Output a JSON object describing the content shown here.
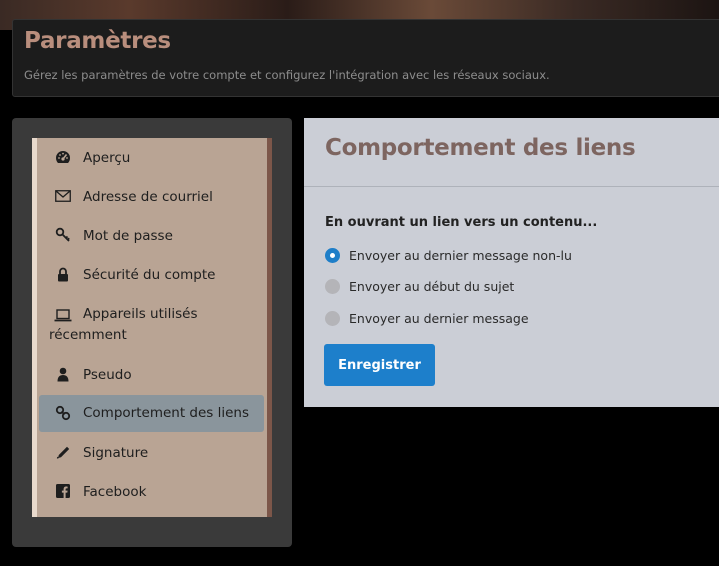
{
  "header": {
    "title": "Paramètres",
    "subtitle": "Gérez les paramètres de votre compte et configurez l'intégration avec les réseaux sociaux."
  },
  "sidebar": {
    "items": [
      {
        "label": "Aperçu",
        "icon": "gauge-icon"
      },
      {
        "label": "Adresse de courriel",
        "icon": "envelope-icon"
      },
      {
        "label": "Mot de passe",
        "icon": "key-icon"
      },
      {
        "label": "Sécurité du compte",
        "icon": "lock-icon"
      },
      {
        "label": "Appareils utilisés récemment",
        "label_line1": "Appareils utilisés",
        "label_line2": "récemment",
        "icon": "laptop-icon"
      },
      {
        "label": "Pseudo",
        "icon": "user-icon"
      },
      {
        "label": "Comportement des liens",
        "icon": "link-icon",
        "active": true
      },
      {
        "label": "Signature",
        "icon": "pencil-icon"
      },
      {
        "label": "Facebook",
        "icon": "facebook-icon"
      }
    ]
  },
  "panel": {
    "title": "Comportement des liens",
    "question": "En ouvrant un lien vers un contenu...",
    "options": [
      {
        "label": "Envoyer au dernier message non-lu",
        "selected": true
      },
      {
        "label": "Envoyer au début du sujet",
        "selected": false
      },
      {
        "label": "Envoyer au dernier message",
        "selected": false
      }
    ],
    "save_label": "Enregistrer"
  },
  "colors": {
    "accent": "#1d7fcb",
    "title_brown": "#b98e7d",
    "sidebar_bg": "#b9a494",
    "active_item": "#8a959c",
    "panel_bg": "#cbced6"
  }
}
